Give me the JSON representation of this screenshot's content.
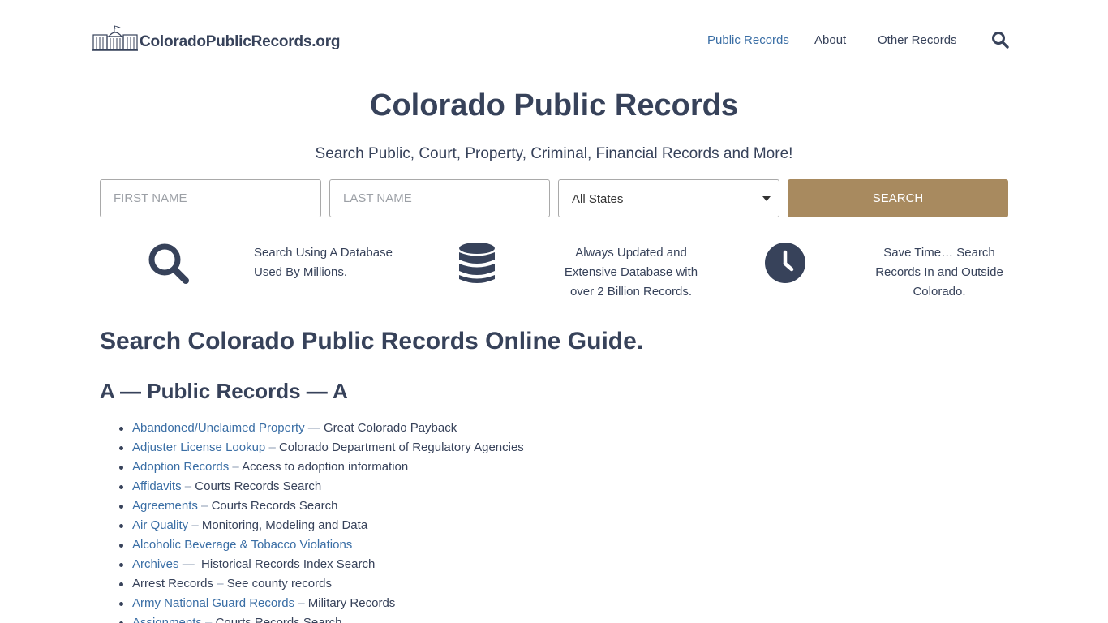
{
  "header": {
    "logo_text": "ColoradoPublicRecords.org",
    "logo_icon": "capitol-building-icon",
    "nav": [
      {
        "label": "Public Records"
      },
      {
        "label": "About"
      },
      {
        "label": "Other Records"
      }
    ],
    "search_icon": "search-icon"
  },
  "hero": {
    "title": "Colorado Public Records",
    "subtitle": "Search Public, Court, Property, Criminal, Financial Records and More!"
  },
  "search_form": {
    "first_name_placeholder": "FIRST NAME",
    "last_name_placeholder": "LAST NAME",
    "state_selected": "All States",
    "button_label": "SEARCH"
  },
  "features": [
    {
      "icon": "search-icon",
      "line1": "Search Using A Database",
      "line2": "Used By Millions.",
      "line3": ""
    },
    {
      "icon": "database-icon",
      "line1": "Always Updated and",
      "line2": "Extensive Database with",
      "line3": "over 2 Billion Records."
    },
    {
      "icon": "clock-icon",
      "line1": "Save Time… Search",
      "line2": "Records In and Outside",
      "line3": "Colorado."
    }
  ],
  "guide": {
    "title": "Search Colorado Public Records Online Guide.",
    "section_title": "A — Public Records — A",
    "items": [
      {
        "link": "Abandoned/Unclaimed Property",
        "sep": " — ",
        "desc": "Great Colorado Payback"
      },
      {
        "link": "Adjuster License Lookup",
        "sep": " – ",
        "desc": "Colorado Department of Regulatory Agencies"
      },
      {
        "link": "Adoption Records",
        "sep": " – ",
        "desc": "Access to adoption information"
      },
      {
        "link": "Affidavits",
        "sep": " – ",
        "desc": "Courts Records Search"
      },
      {
        "link": "Agreements",
        "sep": " – ",
        "desc": "Courts Records Search"
      },
      {
        "link": "Air Quality",
        "sep": " – ",
        "desc": "Monitoring, Modeling and Data"
      },
      {
        "link": "Alcoholic Beverage & Tobacco Violations",
        "sep": "",
        "desc": ""
      },
      {
        "link": "Archives",
        "sep": " —  ",
        "desc": "Historical Records Index Search"
      },
      {
        "text": "Arrest Records",
        "sep": " – ",
        "desc": "See county records"
      },
      {
        "link": "Army National Guard Records",
        "sep": " – ",
        "desc": "Military Records"
      },
      {
        "link": "Assignments",
        "sep": " – ",
        "desc": "Courts Records Search"
      }
    ]
  },
  "colors": {
    "text_dark": "#37425a",
    "link_blue": "#3a6ea5",
    "button_gold": "#a88a5f"
  }
}
